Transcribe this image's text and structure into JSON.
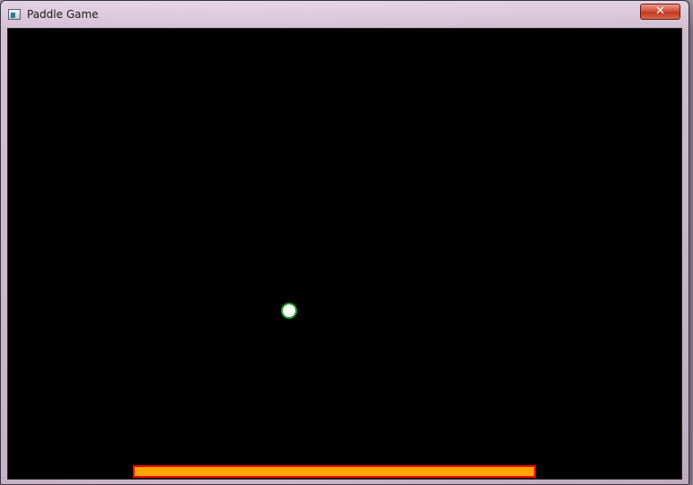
{
  "window": {
    "title": "Paddle Game",
    "close_label": "✕"
  },
  "game": {
    "ball": {
      "fill_color": "#ffffff",
      "outline_color": "#1f9d1f"
    },
    "paddle": {
      "fill_color": "#ffa500",
      "outline_color": "#ff0000"
    },
    "background_color": "#000000"
  }
}
